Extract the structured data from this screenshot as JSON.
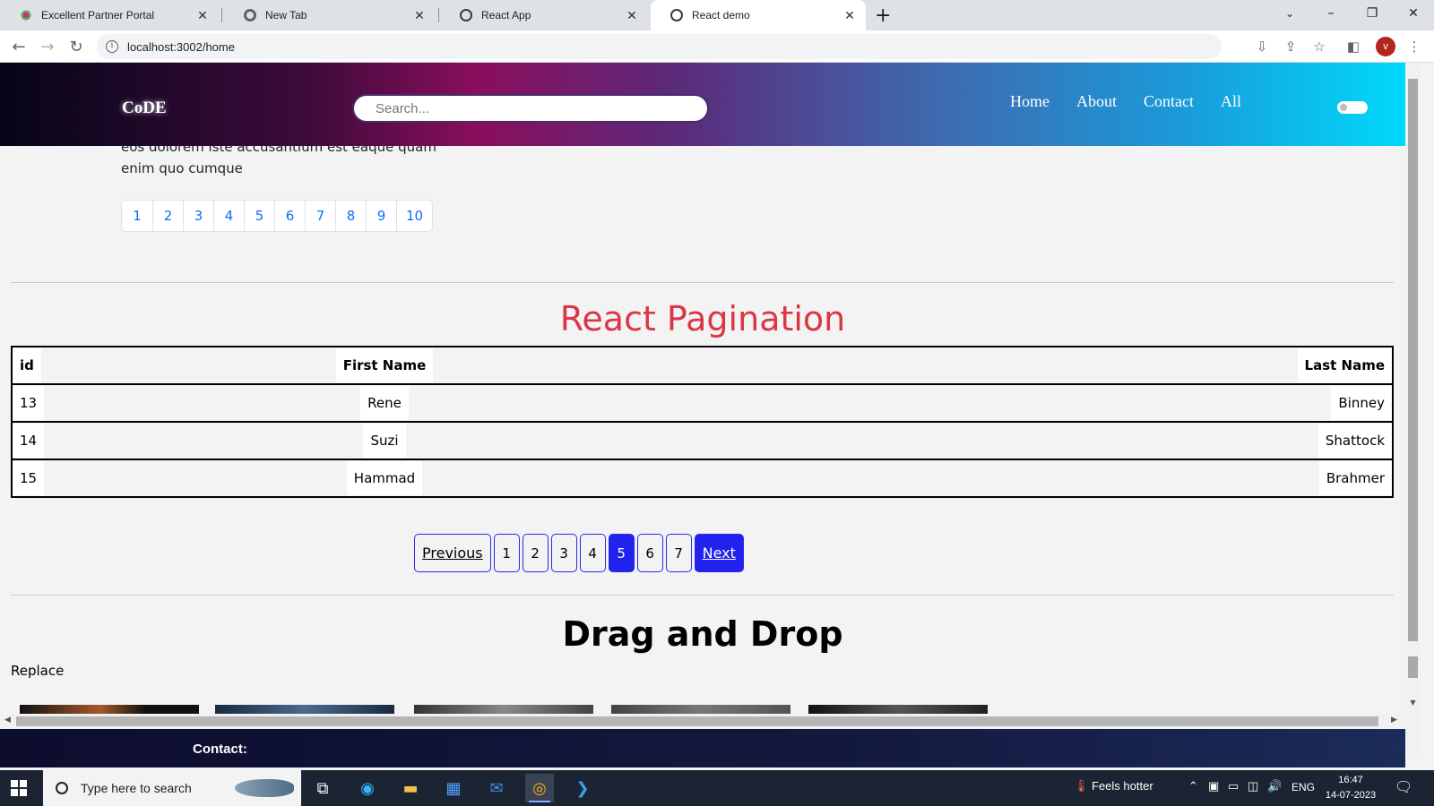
{
  "browser": {
    "tabs": [
      {
        "label": "Excellent Partner Portal",
        "active": false
      },
      {
        "label": "New Tab",
        "active": false
      },
      {
        "label": "React App",
        "active": false
      },
      {
        "label": "React demo",
        "active": true
      }
    ],
    "url": "localhost:3002/home",
    "profile_initial": "v"
  },
  "app": {
    "brand": "CoDE",
    "search_placeholder": "Search...",
    "nav": [
      "Home",
      "About",
      "Contact",
      "All"
    ]
  },
  "content": {
    "para_line1": "eos dolorem iste accusantium est eaque quam",
    "para_line2": "enim quo cumque",
    "pager1": [
      "1",
      "2",
      "3",
      "4",
      "5",
      "6",
      "7",
      "8",
      "9",
      "10"
    ],
    "pagination_title": "React Pagination",
    "table": {
      "headers": [
        "id",
        "First Name",
        "Last Name"
      ],
      "rows": [
        [
          "13",
          "Rene",
          "Binney"
        ],
        [
          "14",
          "Suzi",
          "Shattock"
        ],
        [
          "15",
          "Hammad",
          "Brahmer"
        ]
      ]
    },
    "pager2": {
      "previous": "Previous",
      "pages": [
        "1",
        "2",
        "3",
        "4",
        "5",
        "6",
        "7"
      ],
      "active_page": "5",
      "next": "Next"
    },
    "dnd_title": "Drag and Drop",
    "replace_label": "Replace",
    "footer_contact": "Contact:"
  },
  "taskbar": {
    "search_placeholder": "Type here to search",
    "weather": "Feels hotter",
    "language": "ENG",
    "time": "16:47",
    "date": "14-07-2023"
  },
  "colors": {
    "pagination_title": "#dc3545",
    "active_page": "#2222ee",
    "link_blue": "#0d6efd"
  }
}
